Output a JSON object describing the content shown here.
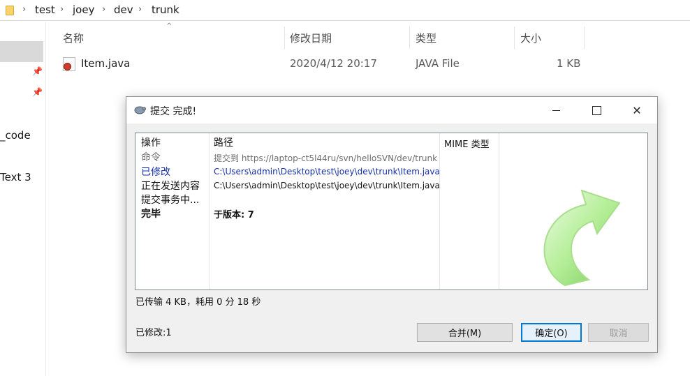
{
  "explorer": {
    "breadcrumb": [
      "test",
      "joey",
      "dev",
      "trunk"
    ],
    "nav_texts": [
      "_code",
      "Text 3"
    ],
    "columns": {
      "name": "名称",
      "modified": "修改日期",
      "type": "类型",
      "size": "大小"
    },
    "file": {
      "name": "Item.java",
      "modified": "2020/4/12 20:17",
      "type": "JAVA File",
      "size": "1 KB"
    }
  },
  "dialog": {
    "title": "提交 完成!",
    "headers": {
      "action": "操作",
      "path": "路径",
      "mime": "MIME 类型"
    },
    "rows": [
      {
        "action": "命令",
        "path": "提交到 https://laptop-ct5l44ru/svn/helloSVN/dev/trunk",
        "style": "grey"
      },
      {
        "action": "已修改",
        "path": "C:\\Users\\admin\\Desktop\\test\\joey\\dev\\trunk\\Item.java",
        "style": "blue"
      },
      {
        "action": "正在发送内容",
        "path": "C:\\Users\\admin\\Desktop\\test\\joey\\dev\\trunk\\Item.java",
        "style": "black"
      },
      {
        "action": "提交事务中...",
        "path": "",
        "style": "black"
      },
      {
        "action": "完毕",
        "path": "于版本: 7",
        "style": "bold"
      }
    ],
    "status": "已传输 4 KB，耗用 0 分 18 秒",
    "modified_count": "已修改:1",
    "buttons": {
      "merge": "合并(M)",
      "ok": "确定(O)",
      "cancel": "取消"
    }
  },
  "colors": {
    "accent": "#0078d7",
    "modified_text": "#1530a8",
    "arrow_green": "#7ed957"
  }
}
